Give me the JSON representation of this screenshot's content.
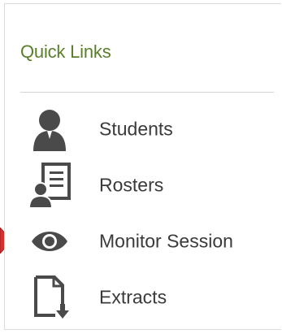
{
  "panel": {
    "title": "Quick Links",
    "title_color": "#5a7f2a"
  },
  "links": [
    {
      "label": "Students",
      "icon": "user-icon"
    },
    {
      "label": "Rosters",
      "icon": "roster-list-icon"
    },
    {
      "label": "Monitor Session",
      "icon": "eye-icon"
    },
    {
      "label": "Extracts",
      "icon": "document-download-icon"
    }
  ],
  "indicator": {
    "icon": "red-arrow-pointer",
    "color": "#d62f2f",
    "points_to": "Monitor Session"
  }
}
